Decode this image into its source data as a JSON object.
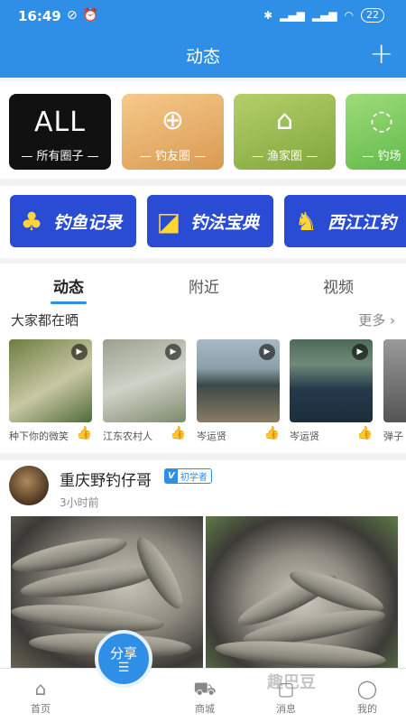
{
  "status_bar": {
    "time": "16:49",
    "battery": "22"
  },
  "header": {
    "title": "动态",
    "add_symbol": "+"
  },
  "circles": [
    {
      "big_text": "ALL",
      "label": "— 所有圈子 —"
    },
    {
      "label": "— 钓友圈 —"
    },
    {
      "label": "— 渔家圈 —"
    },
    {
      "label": "— 钓场"
    }
  ],
  "banners": [
    {
      "label": "钓鱼记录"
    },
    {
      "label": "钓法宝典"
    },
    {
      "label": "西江江钓"
    }
  ],
  "tabs": [
    {
      "label": "动态",
      "active": true
    },
    {
      "label": "附近",
      "active": false
    },
    {
      "label": "视频",
      "active": false
    }
  ],
  "shares": {
    "title": "大家都在晒",
    "more": "更多",
    "videos": [
      {
        "caption": "种下你的微笑"
      },
      {
        "caption": "江东农村人"
      },
      {
        "caption": "岑运贤"
      },
      {
        "caption": "岑运贤"
      },
      {
        "caption": "弹子"
      }
    ]
  },
  "post": {
    "author": "重庆野钓仔哥",
    "badge_v": "V",
    "badge": "初学者",
    "time": "3小时前"
  },
  "fab": {
    "label": "分享"
  },
  "nav": [
    {
      "label": "首页",
      "icon": "home-icon"
    },
    {
      "label": "商城",
      "icon": "cart-icon"
    },
    {
      "label": "消息",
      "icon": "message-icon"
    },
    {
      "label": "我的",
      "icon": "user-icon"
    }
  ],
  "watermark": "趣巴豆",
  "colors": {
    "primary": "#2f8fe6",
    "banner": "#2a4bd3",
    "banner_icon": "#ffd633"
  }
}
